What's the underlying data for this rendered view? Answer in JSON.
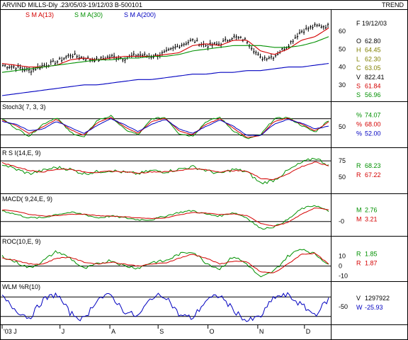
{
  "header": {
    "title": "ARVIND MILLS-Dly .23/05/03-19/12/03  B-500101",
    "right_label": "TREND",
    "legend": [
      {
        "label": "S M A(13)",
        "color": "#d40000"
      },
      {
        "label": "S M A(30)",
        "color": "#009000"
      },
      {
        "label": "S M A(200)",
        "color": "#0000c0"
      }
    ]
  },
  "colors": {
    "price": "#000000",
    "sma13": "#d40000",
    "sma30": "#009000",
    "sma200": "#0000c0",
    "blue": "#0000c0"
  },
  "price_panel": {
    "date_label": "F 19/12/03",
    "axis_ticks": [
      {
        "label": "60",
        "v": 60
      },
      {
        "label": "50",
        "v": 50
      },
      {
        "label": "40",
        "v": 40
      },
      {
        "label": "30",
        "v": 30
      }
    ],
    "readouts": [
      {
        "k": "O",
        "v": "62.80",
        "color": "#000000"
      },
      {
        "k": "H",
        "v": "64.45",
        "color": "#808000"
      },
      {
        "k": "L",
        "v": "62.30",
        "color": "#808000"
      },
      {
        "k": "C",
        "v": "63.05",
        "color": "#808000"
      },
      {
        "k": "V",
        "v": "822.41",
        "color": "#000000"
      },
      {
        "k": "S",
        "v": "61.84",
        "color": "#d40000"
      },
      {
        "k": "S",
        "v": "56.96",
        "color": "#009000"
      }
    ]
  },
  "stoch_panel": {
    "title": "Stoch3( 7, 3, 3)",
    "axis_ticks": [
      {
        "label": "50",
        "v": 50
      }
    ],
    "readouts": [
      {
        "k": "%",
        "v": "74.07",
        "color": "#009000"
      },
      {
        "k": "%",
        "v": "68.00",
        "color": "#d40000"
      },
      {
        "k": "%",
        "v": "52.00",
        "color": "#0000c0"
      }
    ]
  },
  "rsi_panel": {
    "title": "R S I(14,E, 9)",
    "axis_ticks": [
      {
        "label": "75",
        "v": 75
      },
      {
        "label": "50",
        "v": 50
      }
    ],
    "readouts": [
      {
        "k": "R",
        "v": "68.23",
        "color": "#009000"
      },
      {
        "k": "R",
        "v": "67.22",
        "color": "#d40000"
      }
    ]
  },
  "macd_panel": {
    "title": "MACD( 9,24,E, 9)",
    "axis_ticks": [
      {
        "label": "-0",
        "v": 0
      }
    ],
    "readouts": [
      {
        "k": "M",
        "v": "2.76",
        "color": "#009000"
      },
      {
        "k": "M",
        "v": "3.21",
        "color": "#d40000"
      }
    ]
  },
  "roc_panel": {
    "title": "ROC(10,E, 9)",
    "axis_ticks": [
      {
        "label": "10",
        "v": 10
      },
      {
        "label": "0",
        "v": 0
      },
      {
        "label": "-10",
        "v": -10
      }
    ],
    "readouts": [
      {
        "k": "R",
        "v": "1.85",
        "color": "#009000"
      },
      {
        "k": "R",
        "v": "1.87",
        "color": "#d40000"
      }
    ]
  },
  "wlm_panel": {
    "title": "WLM %R(10)",
    "axis_ticks": [
      {
        "label": "-50",
        "v": -50
      }
    ],
    "readouts": [
      {
        "k": "V",
        "v": "1297922",
        "color": "#000000"
      },
      {
        "k": "W",
        "v": "-25.93",
        "color": "#0000c0"
      }
    ]
  },
  "x_axis": {
    "ticks": [
      {
        "label": "'03 J",
        "frac": 0.0
      },
      {
        "label": "J",
        "frac": 0.18
      },
      {
        "label": "A",
        "frac": 0.335
      },
      {
        "label": "S",
        "frac": 0.485
      },
      {
        "label": "O",
        "frac": 0.64
      },
      {
        "label": "N",
        "frac": 0.795
      },
      {
        "label": "D",
        "frac": 0.94
      }
    ]
  },
  "chart_data": [
    {
      "type": "line",
      "title": "ARVIND MILLS-Dly .23/05/03-19/12/03  B-500101",
      "series": [
        {
          "name": "S M A(13)",
          "values": [
            42,
            41,
            40,
            40,
            41,
            44,
            45,
            44,
            45,
            46,
            46,
            46,
            47,
            48,
            52,
            53,
            52,
            55,
            55,
            49,
            47,
            50,
            55,
            57,
            61.84
          ]
        },
        {
          "name": "S M A(30)",
          "values": [
            37,
            38,
            39,
            40,
            41,
            42,
            43,
            44,
            44,
            45,
            45,
            46,
            46,
            47,
            49,
            50,
            51,
            52,
            52,
            52,
            51,
            51,
            52,
            54,
            56.96
          ]
        },
        {
          "name": "S M A(200)",
          "values": [
            24,
            25,
            26,
            27,
            28,
            29,
            30,
            30,
            31,
            32,
            33,
            33,
            34,
            35,
            36,
            36,
            37,
            37,
            38,
            38,
            39,
            40,
            40,
            41,
            42
          ]
        }
      ],
      "price_close": [
        41,
        40,
        38,
        41,
        43,
        47,
        45,
        44,
        46,
        45,
        47,
        46,
        48,
        52,
        55,
        52,
        53,
        57,
        55,
        45,
        46,
        52,
        60,
        63,
        63.05
      ],
      "ylim": [
        22,
        68
      ],
      "ohlc_last": {
        "open": 62.8,
        "high": 64.45,
        "low": 62.3,
        "close": 63.05,
        "volume": 822.41
      }
    },
    {
      "type": "line",
      "title": "Stoch3( 7, 3, 3)",
      "series": [
        {
          "name": "%K",
          "values": [
            80,
            45,
            15,
            60,
            85,
            30,
            10,
            75,
            90,
            40,
            20,
            80,
            85,
            25,
            15,
            70,
            85,
            35,
            5,
            20,
            80,
            85,
            55,
            30,
            74.07
          ]
        },
        {
          "name": "%D",
          "values": [
            75,
            55,
            25,
            50,
            78,
            40,
            18,
            65,
            85,
            50,
            25,
            70,
            82,
            35,
            20,
            60,
            80,
            45,
            10,
            18,
            70,
            82,
            60,
            35,
            68.0
          ]
        },
        {
          "name": "%D slow",
          "values": [
            70,
            60,
            35,
            42,
            70,
            48,
            25,
            55,
            80,
            58,
            32,
            60,
            78,
            42,
            25,
            52,
            75,
            52,
            18,
            18,
            60,
            78,
            64,
            42,
            52.0
          ]
        }
      ],
      "ylim": [
        0,
        100
      ]
    },
    {
      "type": "line",
      "title": "R S I(14,E, 9)",
      "series": [
        {
          "name": "RSI",
          "values": [
            70,
            62,
            55,
            60,
            65,
            62,
            55,
            58,
            60,
            57,
            55,
            60,
            58,
            62,
            66,
            60,
            55,
            62,
            58,
            40,
            45,
            60,
            72,
            80,
            68.23
          ]
        },
        {
          "name": "Signal",
          "values": [
            72,
            66,
            60,
            58,
            62,
            62,
            58,
            57,
            59,
            58,
            56,
            58,
            58,
            60,
            63,
            61,
            58,
            60,
            59,
            48,
            46,
            55,
            66,
            73,
            67.22
          ]
        }
      ],
      "ylim": [
        30,
        85
      ]
    },
    {
      "type": "line",
      "title": "MACD( 9,24,E, 9)",
      "series": [
        {
          "name": "MACD",
          "values": [
            3.0,
            2.0,
            1.0,
            1.0,
            2.0,
            2.5,
            2.0,
            1.0,
            1.5,
            1.0,
            0.5,
            0.5,
            1.5,
            2.5,
            3.0,
            2.0,
            1.5,
            2.5,
            1.0,
            -2.0,
            -1.5,
            0.5,
            3.5,
            4.5,
            2.76
          ]
        },
        {
          "name": "Signal",
          "values": [
            3.2,
            2.8,
            2.0,
            1.5,
            1.6,
            2.0,
            2.0,
            1.6,
            1.5,
            1.3,
            1.0,
            0.8,
            1.0,
            1.8,
            2.5,
            2.3,
            1.9,
            2.1,
            1.6,
            -0.5,
            -1.3,
            -0.3,
            2.0,
            3.8,
            3.21
          ]
        }
      ],
      "ylim": [
        -3,
        6
      ]
    },
    {
      "type": "line",
      "title": "ROC(10,E, 9)",
      "series": [
        {
          "name": "ROC",
          "values": [
            10,
            4,
            -2,
            5,
            15,
            8,
            -3,
            2,
            6,
            0,
            -2,
            4,
            5,
            12,
            15,
            3,
            -3,
            10,
            2,
            -12,
            -5,
            10,
            18,
            12,
            1.85
          ]
        },
        {
          "name": "Signal",
          "values": [
            8,
            6,
            2,
            2,
            8,
            9,
            4,
            2,
            4,
            2,
            0,
            2,
            3,
            8,
            12,
            8,
            2,
            5,
            4,
            -6,
            -7,
            2,
            12,
            13,
            1.87
          ]
        }
      ],
      "ylim": [
        -14,
        22
      ]
    },
    {
      "type": "line",
      "title": "WLM %R(10)",
      "series": [
        {
          "name": "%R",
          "values": [
            -20,
            -60,
            -85,
            -30,
            -10,
            -70,
            -90,
            -25,
            -15,
            -65,
            -80,
            -20,
            -15,
            -75,
            -85,
            -30,
            -15,
            -60,
            -95,
            -80,
            -20,
            -15,
            -45,
            -75,
            -25.93
          ]
        }
      ],
      "ylim": [
        -100,
        0
      ]
    }
  ]
}
